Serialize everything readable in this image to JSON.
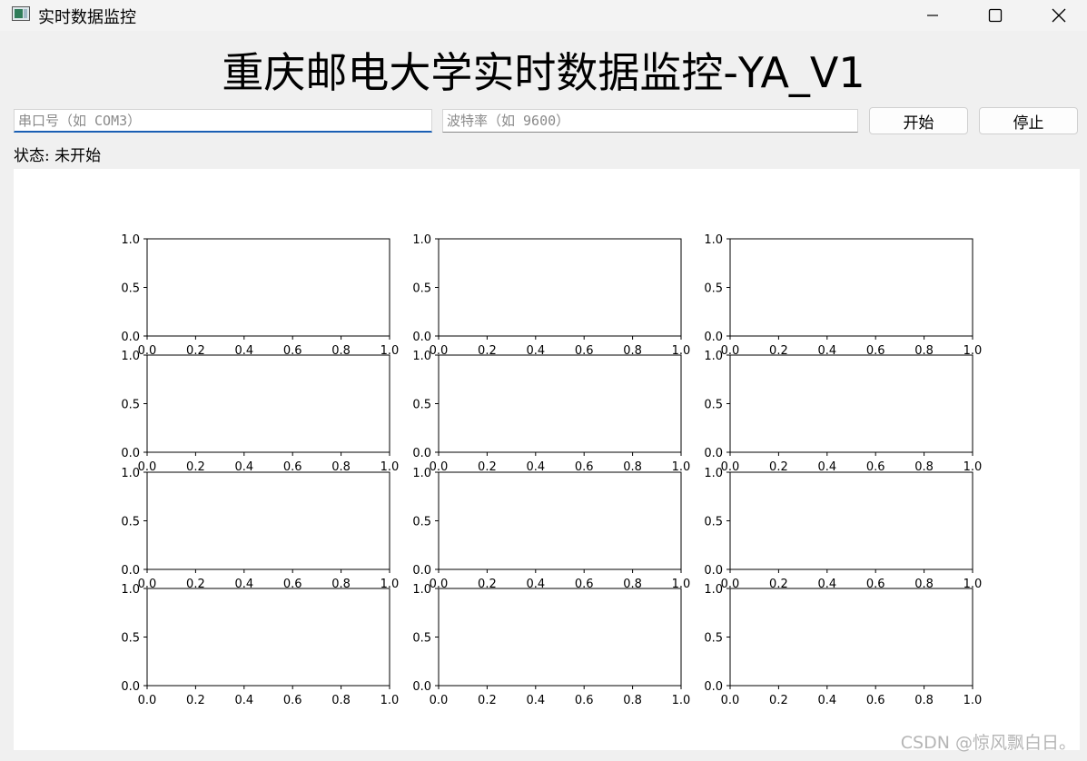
{
  "window": {
    "title": "实时数据监控",
    "icon": "app-window-icon",
    "controls": [
      "minimize-icon",
      "maximize-icon",
      "close-icon"
    ]
  },
  "headline": "重庆邮电大学实时数据监控-YA_V1",
  "inputs": {
    "port_placeholder": "串口号（如 COM3）",
    "port_value": "",
    "baud_placeholder": "波特率（如 9600）",
    "baud_value": ""
  },
  "buttons": {
    "start": "开始",
    "stop": "停止"
  },
  "status": "状态: 未开始",
  "watermark": "CSDN @惊风飘白日。",
  "colors": {
    "focus_underline": "#1a5fb4",
    "placeholder": "#8a8a8a",
    "window_bg": "#f0f0f0",
    "plot_bg": "#ffffff"
  },
  "chart_data": {
    "type": "line",
    "grid": "4 rows x 3 columns",
    "subplots": 12,
    "series": [],
    "xlim": [
      0.0,
      1.0
    ],
    "ylim": [
      0.0,
      1.0
    ],
    "xticks": [
      "0.0",
      "0.2",
      "0.4",
      "0.6",
      "0.8",
      "1.0"
    ],
    "yticks": [
      "0.0",
      "0.5",
      "1.0"
    ],
    "gridlines": false
  }
}
